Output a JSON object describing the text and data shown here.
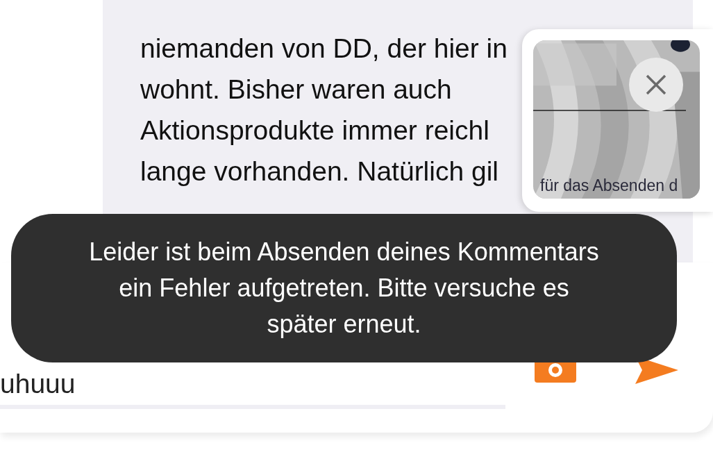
{
  "comment": {
    "lines": [
      "niemanden von DD, der hier in",
      "wohnt. Bisher waren auch",
      "Aktionsprodukte immer reichl",
      "lange vorhanden. Natürlich gil"
    ]
  },
  "screenshot_preview": {
    "caption": "für das Absenden d"
  },
  "toast": {
    "lines": [
      "Leider ist beim Absenden deines Kommentars",
      "ein Fehler aufgetreten. Bitte versuche es",
      "später erneut."
    ]
  },
  "composer": {
    "lines": [
      "uhuuu"
    ]
  }
}
